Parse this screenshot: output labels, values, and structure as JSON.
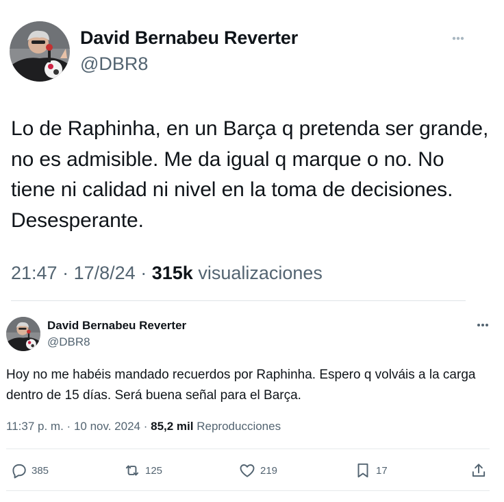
{
  "tweet_main": {
    "name": "David Bernabeu Reverter",
    "handle": "@DBR8",
    "text": "Lo de Raphinha, en un Barça q pretenda ser grande, no es admisible. Me da igual q marque o no. No tiene ni calidad ni nivel en la toma de decisiones. Desesperante.",
    "time": "21:47",
    "date": "17/8/24",
    "views_count": "315k",
    "views_label": "visualizaciones",
    "separator": "·",
    "more_icon": "more-dots-icon"
  },
  "tweet_reply": {
    "name": "David Bernabeu Reverter",
    "handle": "@DBR8",
    "text": "Hoy no me habéis mandado recuerdos por Raphinha. Espero q volváis a la carga dentro de 15 días. Será buena señal para el Barça.",
    "time": "11:37 p. m.",
    "date": "10 nov. 2024",
    "views_count": "85,2 mil",
    "views_label": "Reproducciones",
    "separator": "·",
    "more_icon": "more-dots-icon",
    "actions": {
      "replies": "385",
      "retweets": "125",
      "likes": "219",
      "bookmarks": "17"
    }
  },
  "colors": {
    "text_primary": "#0f1419",
    "text_secondary": "#536471",
    "divider": "#dfe3e6"
  }
}
